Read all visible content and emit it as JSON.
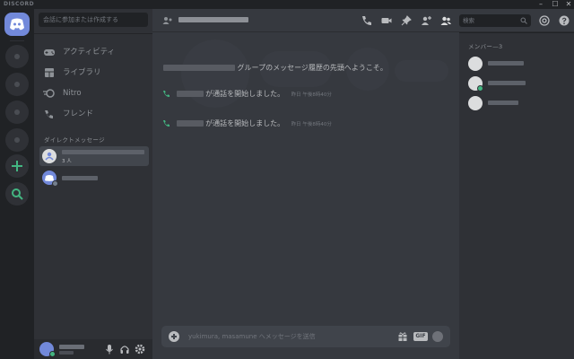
{
  "app": {
    "brand": "DISCORD"
  },
  "window_controls": [
    "–",
    "☐",
    "✕"
  ],
  "sidebar": {
    "search_placeholder": "会話に参加または作成する",
    "nav": [
      {
        "label": "アクティビティ",
        "icon": "gamepad-icon"
      },
      {
        "label": "ライブラリ",
        "icon": "library-icon"
      },
      {
        "label": "Nitro",
        "icon": "nitro-icon"
      },
      {
        "label": "フレンド",
        "icon": "friends-icon"
      }
    ],
    "dm_header": "ダイレクトメッセージ",
    "dms": [
      {
        "subtitle": "3 人",
        "icon": "group-dm-icon"
      },
      {
        "subtitle": "",
        "icon": "discord-avatar-icon"
      }
    ]
  },
  "chat": {
    "welcome_suffix": "グループのメッセージ履歴の先頭へようこそ。",
    "system_messages": [
      {
        "text": "が通話を開始しました。",
        "time": "昨日 午後8時40分"
      },
      {
        "text": "が通話を開始しました。",
        "time": "昨日 午後8時40分"
      }
    ],
    "composer_placeholder": "yukimura, masamune へメッセージを送信",
    "gif_label": "GIF"
  },
  "toolbar": {
    "search_placeholder": "検索"
  },
  "members": {
    "header": "メンバー—3",
    "list": [
      {
        "status": "none"
      },
      {
        "status": "online"
      },
      {
        "status": "none"
      }
    ]
  },
  "colors": {
    "blurple": "#7289da",
    "online": "#43b581",
    "bg_dark": "#202225",
    "bg_sidebar": "#2f3136",
    "bg_chat": "#36393f"
  }
}
